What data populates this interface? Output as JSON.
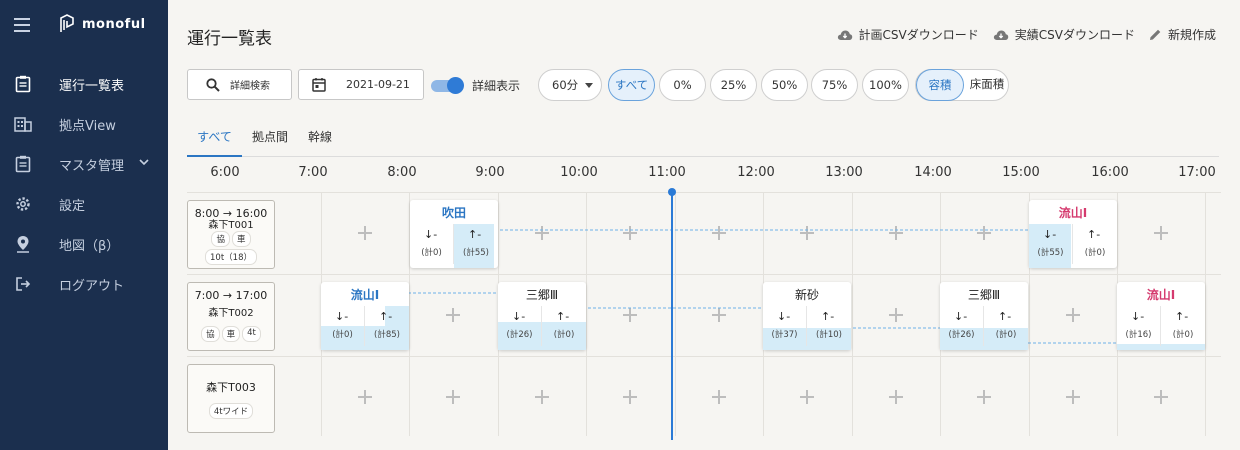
{
  "sidebar": {
    "brand": "monoful",
    "items": [
      {
        "label": "運行一覧表",
        "icon": "clipboard-icon",
        "active": true
      },
      {
        "label": "拠点View",
        "icon": "building-icon"
      },
      {
        "label": "マスタ管理",
        "icon": "clipboard-list-icon"
      },
      {
        "label": "設定",
        "icon": "gear-icon"
      },
      {
        "label": "地図（β）",
        "icon": "map-pin-icon"
      },
      {
        "label": "ログアウト",
        "icon": "logout-icon"
      }
    ]
  },
  "header": {
    "title": "運行一覧表",
    "actions": [
      "計画CSVダウンロード",
      "実績CSVダウンロード",
      "新規作成"
    ]
  },
  "toolbar": {
    "search_label": "詳細検索",
    "date": "2021-09-21",
    "detail_label": "詳細表示",
    "interval": "60分",
    "filters": [
      "すべて",
      "0%",
      "25%",
      "50%",
      "75%",
      "100%"
    ],
    "metric_options": [
      "容積",
      "床面積"
    ]
  },
  "tabs": [
    "すべて",
    "拠点間",
    "幹線"
  ],
  "timeline": {
    "hours": [
      "6:00",
      "7:00",
      "8:00",
      "9:00",
      "10:00",
      "11:00",
      "12:00",
      "13:00",
      "14:00",
      "15:00",
      "16:00",
      "17:00"
    ]
  },
  "vehicles": [
    {
      "time": "8:00 → 16:00",
      "id": "森下T001",
      "tags": [
        "協",
        "車"
      ],
      "tags2": [
        "10t（18）"
      ]
    },
    {
      "time": "7:00 → 17:00",
      "id": "森下T002",
      "tags": [
        "協",
        "車",
        "4t"
      ],
      "tags2": []
    },
    {
      "time": "",
      "id": "森下T003",
      "tags": [
        "4tワイド"
      ],
      "tags2": []
    }
  ],
  "cards": [
    {
      "name": "吹田",
      "down": "↓-",
      "up": "↑-",
      "down_cnt": "(計0)",
      "up_cnt": "(計55)"
    },
    {
      "name": "流山Ⅰ",
      "down": "↓-",
      "up": "↑-",
      "down_cnt": "(計55)",
      "up_cnt": "(計0)"
    },
    {
      "name": "流山Ⅰ",
      "down": "↓-",
      "up": "↑-",
      "down_cnt": "(計0)",
      "up_cnt": "(計85)"
    },
    {
      "name": "三郷Ⅲ",
      "down": "↓-",
      "up": "↑-",
      "down_cnt": "(計26)",
      "up_cnt": "(計0)"
    },
    {
      "name": "新砂",
      "down": "↓-",
      "up": "↑-",
      "down_cnt": "(計37)",
      "up_cnt": "(計10)"
    },
    {
      "name": "三郷Ⅲ",
      "down": "↓-",
      "up": "↑-",
      "down_cnt": "(計26)",
      "up_cnt": "(計0)"
    },
    {
      "name": "流山Ⅰ",
      "down": "↓-",
      "up": "↑-",
      "down_cnt": "(計16)",
      "up_cnt": "(計0)"
    }
  ],
  "colors": {
    "sidebar": "#1b2f4e",
    "accent": "#2b76c3",
    "pink": "#d53a6e",
    "shade": "#d5ecf8"
  }
}
